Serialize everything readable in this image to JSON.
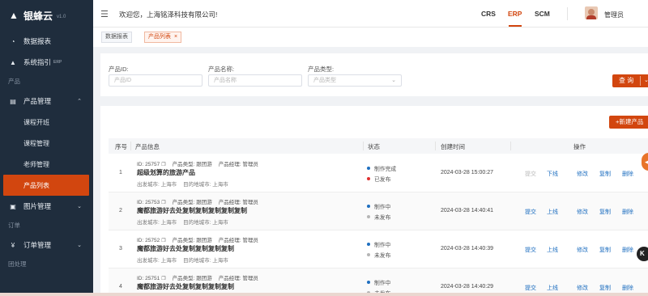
{
  "brand": {
    "name": "银蜂云",
    "version": "v1.0"
  },
  "header": {
    "welcome": "欢迎您，上海铭泽科技有限公司!",
    "systems": [
      {
        "label": "CRS",
        "active": false
      },
      {
        "label": "ERP",
        "active": true
      },
      {
        "label": "SCM",
        "active": false
      }
    ],
    "user": "管理员"
  },
  "sidebar": {
    "data_report": "数据报表",
    "system_guide": "系统指引",
    "system_guide_sup": "ERP",
    "group_product": "产品",
    "product_mgmt": "产品管理",
    "sub_items": [
      "课程开班",
      "课程管理",
      "老师管理",
      "产品列表"
    ],
    "image_mgmt": "图片管理",
    "group_order": "订单",
    "order_mgmt": "订单管理",
    "group_tail": "团处理"
  },
  "tags": [
    {
      "label": "数据报表"
    },
    {
      "label": "产品列表",
      "close": "×"
    }
  ],
  "search": {
    "product_id_label": "产品ID:",
    "product_id_placeholder": "产品ID",
    "product_name_label": "产品名称:",
    "product_name_placeholder": "产品名称",
    "product_type_label": "产品类型:",
    "product_type_placeholder": "产品类型",
    "query_label": "查 询"
  },
  "table": {
    "new_button": "+新建产品",
    "headers": {
      "index": "序号",
      "info": "产品信息",
      "status": "状态",
      "created": "创建时间",
      "ops": "操作"
    },
    "rows": [
      {
        "index": "1",
        "id_line": "ID: 25757",
        "type_line": "产品类型: 跟团游",
        "manager_line": "产品经理: 管理员",
        "name": "超级划算的旅游产品",
        "from_line": "出发城市: 上海市",
        "to_line": "目的地城市: 上海市",
        "status1": "制作完成",
        "status2": "已发布",
        "created": "2024-03-28 15:00:27",
        "ops": [
          "提交",
          "下线",
          "修改",
          "复制",
          "删除"
        ]
      },
      {
        "index": "2",
        "id_line": "ID: 25753",
        "type_line": "产品类型: 跟团游",
        "manager_line": "产品经理: 管理员",
        "name": "魔都旅游好去处复制复制复制复制复制",
        "from_line": "出发城市: 上海市",
        "to_line": "目的地城市: 上海市",
        "status1": "制作中",
        "status2": "未发布",
        "created": "2024-03-28 14:40:41",
        "ops": [
          "提交",
          "上线",
          "修改",
          "复制",
          "删除"
        ]
      },
      {
        "index": "3",
        "id_line": "ID: 25752",
        "type_line": "产品类型: 跟团游",
        "manager_line": "产品经理: 管理员",
        "name": "魔都旅游好去处复制复制复制复制",
        "from_line": "出发城市: 上海市",
        "to_line": "目的地城市: 上海市",
        "status1": "制作中",
        "status2": "未发布",
        "created": "2024-03-28 14:40:39",
        "ops": [
          "提交",
          "上线",
          "修改",
          "复制",
          "删除"
        ]
      },
      {
        "index": "4",
        "id_line": "ID: 25751",
        "type_line": "产品类型: 跟团游",
        "manager_line": "产品经理: 管理员",
        "name": "魔都旅游好去处复制复制复制复制",
        "from_line": "",
        "to_line": "",
        "status1": "制作中",
        "status2": "未发布",
        "created": "2024-03-28 14:40:29",
        "ops": [
          "提交",
          "上线",
          "修改",
          "复制",
          "删除"
        ]
      }
    ]
  },
  "colors": {
    "accent": "#d2460f",
    "sidebar": "#1f2d3d",
    "link": "#1f6fc0",
    "status_blue": "#1f6fc0",
    "status_red": "#e03030",
    "status_gray": "#b5b5b5"
  }
}
